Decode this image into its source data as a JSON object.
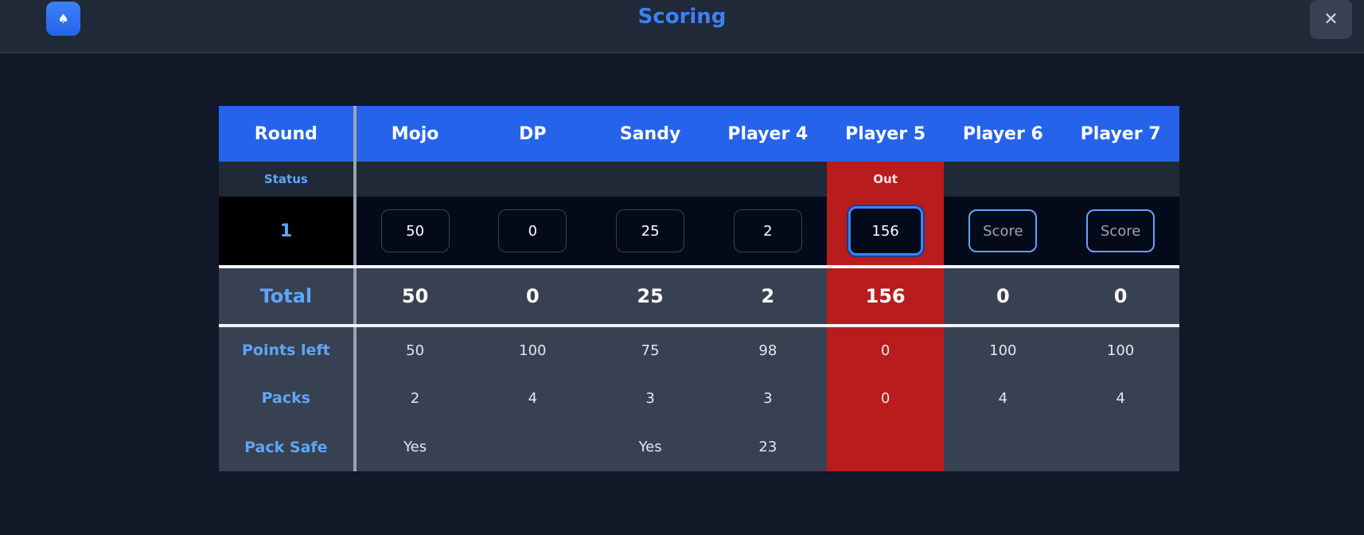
{
  "header": {
    "title": "Scoring",
    "app_icon": "spade-icon",
    "close_icon": "close-icon",
    "close_glyph": "✕",
    "spade_glyph": "♠"
  },
  "colors": {
    "accent": "#2563eb",
    "out": "#b91c1c",
    "label": "#60a5fa",
    "background": "#111827"
  },
  "table": {
    "round_header": "Round",
    "players": [
      "Mojo",
      "DP",
      "Sandy",
      "Player 4",
      "Player 5",
      "Player 6",
      "Player 7"
    ],
    "status_label": "Status",
    "statuses": [
      "",
      "",
      "",
      "",
      "Out",
      "",
      ""
    ],
    "round_number": "1",
    "score_placeholder": "Score",
    "scores": [
      "50",
      "0",
      "25",
      "2",
      "156",
      "",
      ""
    ],
    "total_label": "Total",
    "totals": [
      "50",
      "0",
      "25",
      "2",
      "156",
      "0",
      "0"
    ],
    "points_left_label": "Points left",
    "points_left": [
      "50",
      "100",
      "75",
      "98",
      "0",
      "100",
      "100"
    ],
    "packs_label": "Packs",
    "packs": [
      "2",
      "4",
      "3",
      "3",
      "0",
      "4",
      "4"
    ],
    "pack_safe_label": "Pack Safe",
    "pack_safe": [
      "Yes",
      "",
      "Yes",
      "23",
      "",
      "",
      ""
    ]
  }
}
